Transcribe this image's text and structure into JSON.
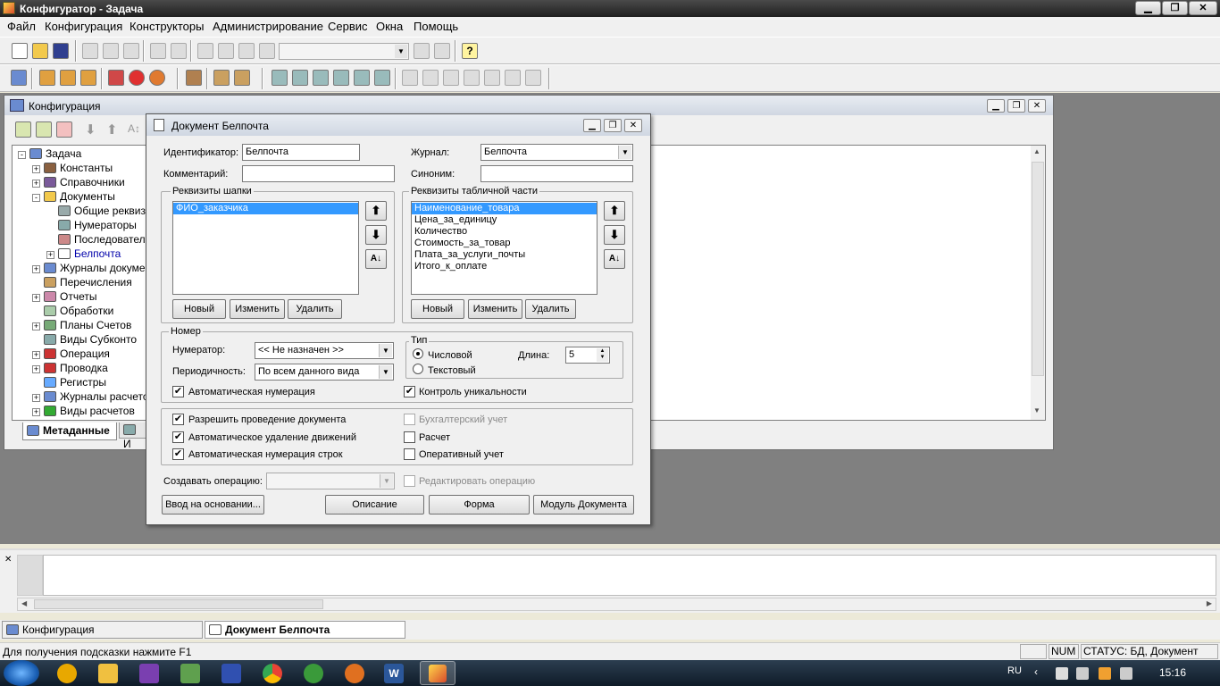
{
  "app": {
    "title": "Конфигуратор - Задача"
  },
  "menu": [
    "Файл",
    "Конфигурация",
    "Конструкторы",
    "Администрирование",
    "Сервис",
    "Окна",
    "Помощь"
  ],
  "config_window": {
    "title": "Конфигурация",
    "tree": [
      {
        "label": "Задача",
        "level": 0,
        "expander": "-"
      },
      {
        "label": "Константы",
        "level": 1,
        "expander": "+"
      },
      {
        "label": "Справочники",
        "level": 1,
        "expander": "+"
      },
      {
        "label": "Документы",
        "level": 1,
        "expander": "-"
      },
      {
        "label": "Общие реквиз",
        "level": 2,
        "expander": ""
      },
      {
        "label": "Нумераторы",
        "level": 2,
        "expander": ""
      },
      {
        "label": "Последовател",
        "level": 2,
        "expander": ""
      },
      {
        "label": "Белпочта",
        "level": 2,
        "expander": "+"
      },
      {
        "label": "Журналы докуме",
        "level": 1,
        "expander": "+"
      },
      {
        "label": "Перечисления",
        "level": 1,
        "expander": ""
      },
      {
        "label": "Отчеты",
        "level": 1,
        "expander": "+"
      },
      {
        "label": "Обработки",
        "level": 1,
        "expander": ""
      },
      {
        "label": "Планы Счетов",
        "level": 1,
        "expander": "+"
      },
      {
        "label": "Виды Субконто",
        "level": 1,
        "expander": ""
      },
      {
        "label": "Операция",
        "level": 1,
        "expander": "+"
      },
      {
        "label": "Проводка",
        "level": 1,
        "expander": "+"
      },
      {
        "label": "Регистры",
        "level": 1,
        "expander": ""
      },
      {
        "label": "Журналы расчето",
        "level": 1,
        "expander": "+"
      },
      {
        "label": "Виды расчетов",
        "level": 1,
        "expander": "+"
      }
    ],
    "tabs": [
      "Метаданные",
      "И"
    ]
  },
  "dialog": {
    "title": "Документ Белпочта",
    "id_label": "Идентификатор:",
    "id_value": "Белпочта",
    "journal_label": "Журнал:",
    "journal_value": "Белпочта",
    "comment_label": "Комментарий:",
    "comment_value": "",
    "synonym_label": "Синоним:",
    "synonym_value": "",
    "header_group": "Реквизиты шапки",
    "header_items": [
      "ФИО_заказчика"
    ],
    "table_group": "Реквизиты табличной части",
    "table_items": [
      "Наименование_товара",
      "Цена_за_единицу",
      "Количество",
      "Стоимость_за_товар",
      "Плата_за_услуги_почты",
      "Итого_к_оплате"
    ],
    "btn_new": "Новый",
    "btn_edit": "Изменить",
    "btn_delete": "Удалить",
    "number_group": "Номер",
    "numerator_label": "Нумератор:",
    "numerator_value": "<< Не назначен >>",
    "period_label": "Периодичность:",
    "period_value": "По всем данного вида",
    "auto_num": "Автоматическая нумерация",
    "type_group": "Тип",
    "type_numeric": "Числовой",
    "type_text": "Текстовый",
    "length_label": "Длина:",
    "length_value": "5",
    "unique_ctrl": "Контроль уникальности",
    "allow_post": "Разрешить проведение документа",
    "auto_delete": "Автоматическое удаление движений",
    "auto_line_num": "Автоматическая нумерация строк",
    "accounting": "Бухгалтерский учет",
    "calc": "Расчет",
    "operative": "Оперативный учет",
    "create_op_label": "Создавать операцию:",
    "create_op_value": "",
    "edit_op": "Редактировать операцию",
    "btn_basis": "Ввод на основании...",
    "btn_desc": "Описание",
    "btn_form": "Форма",
    "btn_module": "Модуль Документа"
  },
  "taskwins": [
    "Конфигурация",
    "Документ Белпочта"
  ],
  "status": {
    "hint": "Для получения подсказки нажмите F1",
    "num": "NUM",
    "state": "СТАТУС: БД, Документ"
  },
  "tray": {
    "lang": "RU",
    "time": "15:16"
  }
}
